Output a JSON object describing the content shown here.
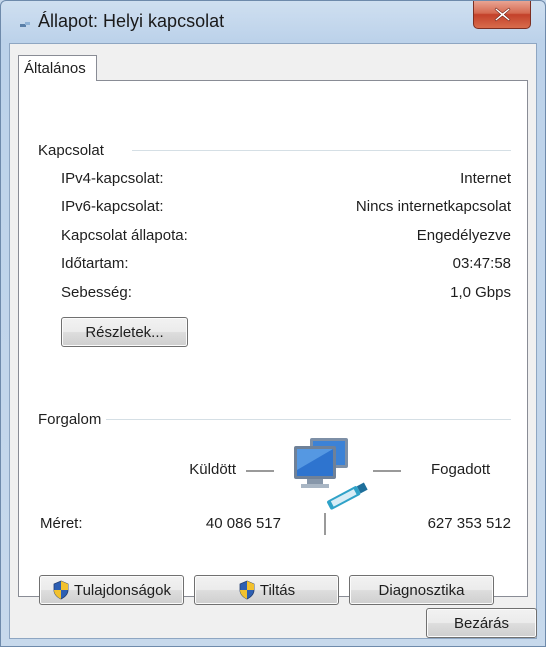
{
  "window": {
    "title": "Állapot: Helyi kapcsolat",
    "close_icon": "close-icon",
    "close_color": "#c3412a"
  },
  "tabs": [
    {
      "label": "Általános"
    }
  ],
  "connection": {
    "group_label": "Kapcsolat",
    "rows": [
      {
        "label": "IPv4-kapcsolat:",
        "value": "Internet"
      },
      {
        "label": "IPv6-kapcsolat:",
        "value": "Nincs internetkapcsolat"
      },
      {
        "label": "Kapcsolat állapota:",
        "value": "Engedélyezve"
      },
      {
        "label": "Időtartam:",
        "value": "03:47:58"
      },
      {
        "label": "Sebesség:",
        "value": "1,0 Gbps"
      }
    ],
    "details_button": "Részletek..."
  },
  "activity": {
    "group_label": "Forgalom",
    "sent_label": "Küldött",
    "received_label": "Fogadott",
    "size_label": "Méret:",
    "sent_value": "40 086 517",
    "received_value": "627 353 512",
    "icon": "network-computers-icon"
  },
  "buttons": {
    "properties": "Tulajdonságok",
    "disable": "Tiltás",
    "diagnose": "Diagnosztika",
    "close": "Bezárás",
    "shield_icon": "uac-shield-icon"
  }
}
